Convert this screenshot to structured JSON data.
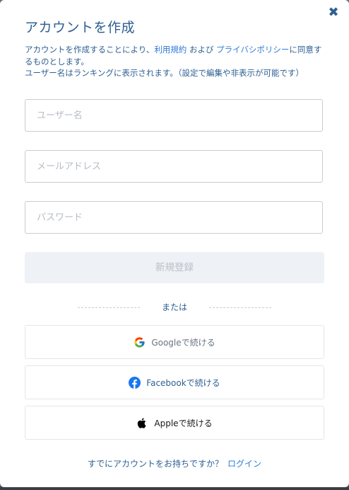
{
  "modal": {
    "title": "アカウントを作成",
    "close_icon": "close-icon"
  },
  "intro": {
    "text_before_terms": "アカウントを作成することにより、",
    "terms_link": "利用規約",
    "text_between": " および ",
    "privacy_link": "プライバシポリシー",
    "text_after": "に同意するものとします。",
    "line2": "ユーザー名はランキングに表示されます。（設定で編集や非表示が可能です）"
  },
  "form": {
    "username_placeholder": "ユーザー名",
    "email_placeholder": "メールアドレス",
    "password_placeholder": "パスワード",
    "username_value": "",
    "email_value": "",
    "password_value": "",
    "submit_label": "新規登録"
  },
  "divider": {
    "text": "または"
  },
  "social": {
    "google_label": "Googleで続ける",
    "facebook_label": "Facebookで続ける",
    "apple_label": "Appleで続ける",
    "google_icon": "google-icon",
    "facebook_icon": "facebook-icon",
    "apple_icon": "apple-icon"
  },
  "footer": {
    "question": "すでにアカウントをお持ちですか？",
    "login_link": "ログイン"
  },
  "colors": {
    "primary_text": "#2e5f93",
    "link": "#2f7bd6",
    "disabled_button_bg": "#eef1f5",
    "disabled_button_text": "#b9c0c9",
    "border": "#c9ccd1"
  }
}
